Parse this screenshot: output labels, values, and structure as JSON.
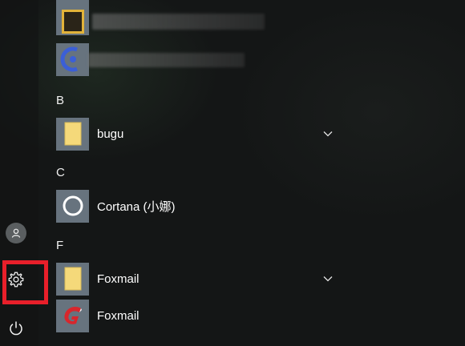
{
  "start_menu": {
    "rail": {
      "account_icon": "user-icon",
      "settings_icon": "gear-icon",
      "power_icon": "power-icon"
    },
    "sections": [
      {
        "letter": "B"
      },
      {
        "letter": "C"
      },
      {
        "letter": "F"
      }
    ],
    "apps": {
      "bugu": {
        "label": "bugu",
        "icon": "folder-icon",
        "expandable": true
      },
      "cortana": {
        "label": "Cortana (小娜)",
        "icon": "cortana-ring-icon"
      },
      "foxmail_folder": {
        "label": "Foxmail",
        "icon": "folder-icon",
        "expandable": true
      },
      "foxmail_app": {
        "label": "Foxmail",
        "icon": "foxmail-logo-icon"
      }
    },
    "colors": {
      "tile": "#67737e",
      "folder": "#f5d97a",
      "highlight": "#e81f2a",
      "foxmail_red": "#d8262c"
    }
  }
}
